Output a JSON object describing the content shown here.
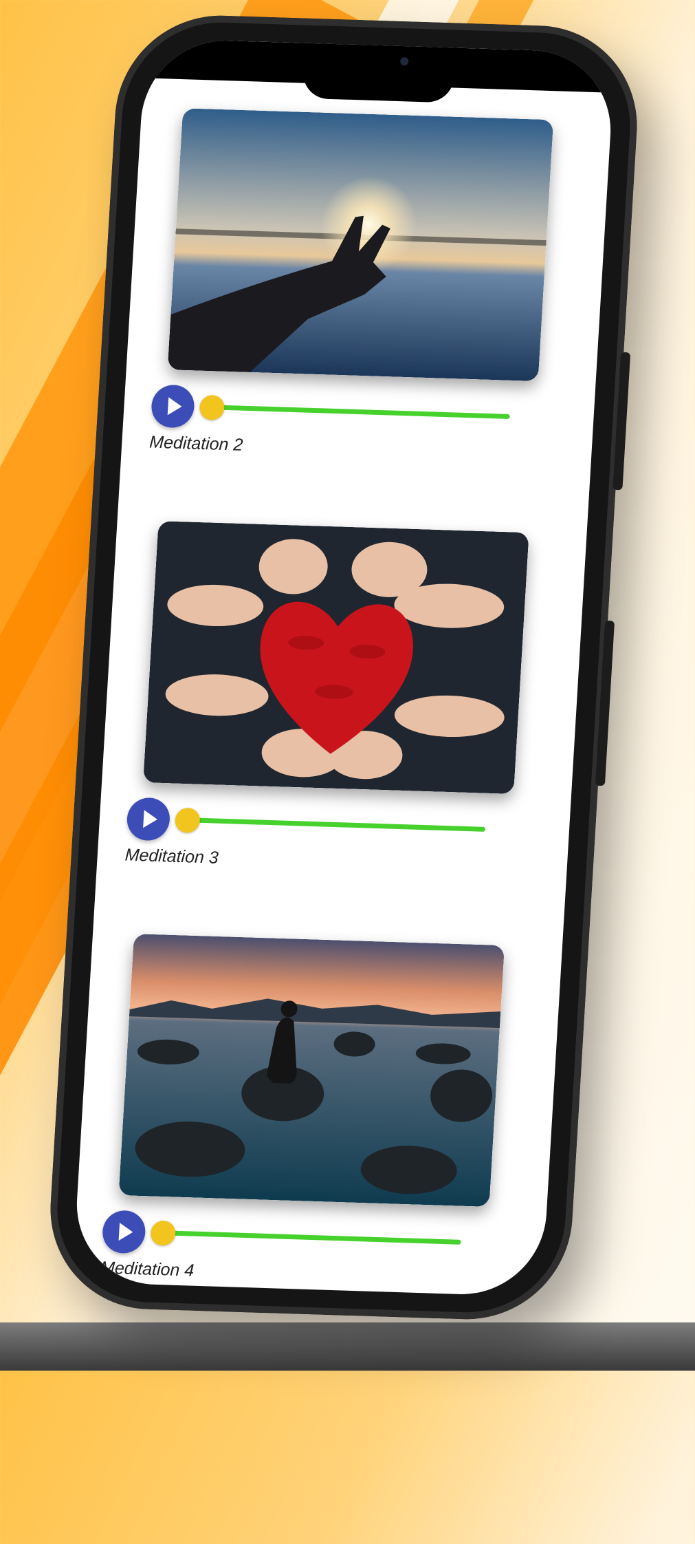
{
  "app": {
    "tracks": [
      {
        "label": "Meditation 2",
        "image": "sunset-hand-photo",
        "progress": 0.0
      },
      {
        "label": "Meditation 3",
        "image": "painted-heart-hands-photo",
        "progress": 0.0
      },
      {
        "label": "Meditation 4",
        "image": "person-sitting-on-rock-photo",
        "progress": 0.0
      }
    ],
    "colors": {
      "play_button": "#3c4db7",
      "progress_track": "#46d12d",
      "progress_knob": "#f2c51e"
    },
    "icons": {
      "play": "play-icon"
    }
  }
}
